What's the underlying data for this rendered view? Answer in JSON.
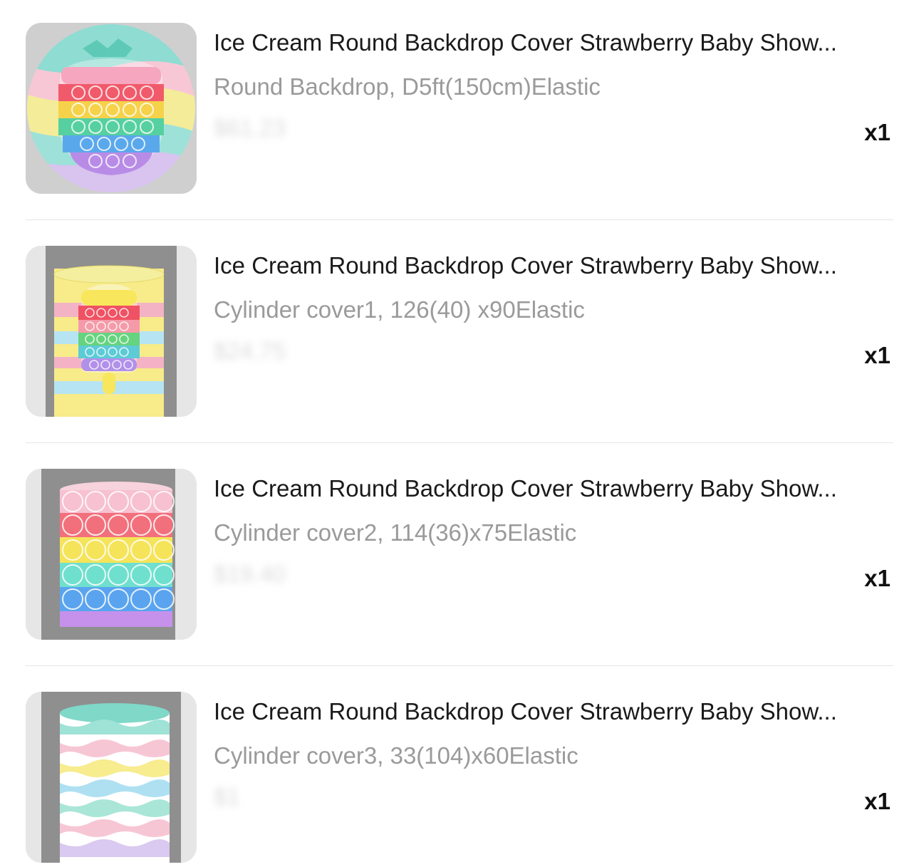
{
  "items": [
    {
      "title": "Ice Cream Round Backdrop Cover Strawberry Baby Show...",
      "variant": "Round Backdrop, D5ft(150cm)Elastic",
      "price": "$61.23",
      "qty": "x1",
      "image": "strawberry-round-backdrop"
    },
    {
      "title": "Ice Cream Round Backdrop Cover Strawberry Baby Show...",
      "variant": "Cylinder cover1, 126(40) x90Elastic",
      "price": "$24.75",
      "qty": "x1",
      "image": "popsicle-cylinder-cover"
    },
    {
      "title": "Ice Cream Round Backdrop Cover Strawberry Baby Show...",
      "variant": "Cylinder cover2, 114(36)x75Elastic",
      "price": "$19.40",
      "qty": "x1",
      "image": "rainbow-bubble-cylinder-cover"
    },
    {
      "title": "Ice Cream Round Backdrop Cover Strawberry Baby Show...",
      "variant": "Cylinder cover3, 33(104)x60Elastic",
      "price": "$1",
      "qty": "x1",
      "image": "pastel-wave-cylinder-cover"
    }
  ]
}
